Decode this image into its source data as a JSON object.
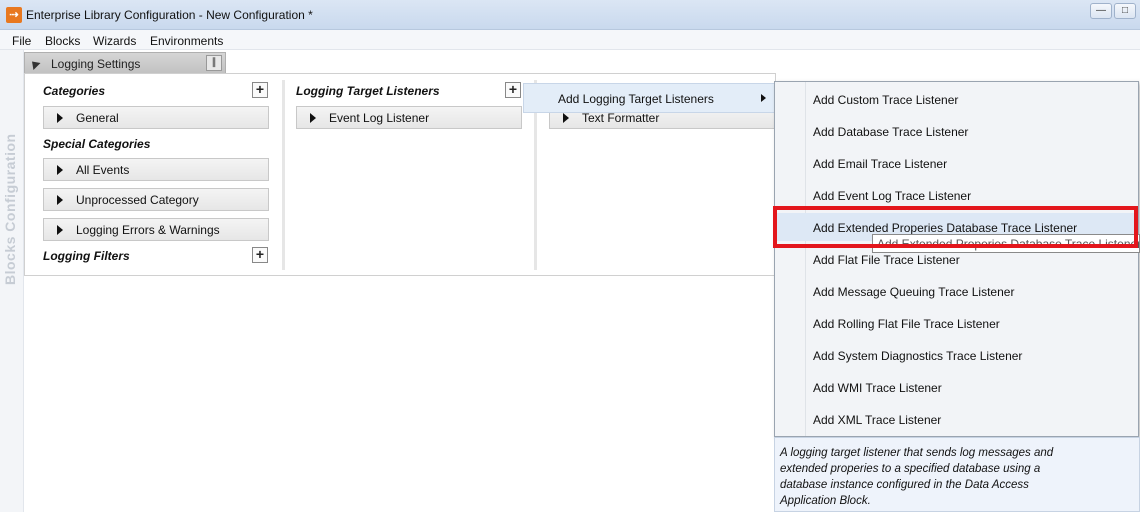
{
  "window": {
    "title": "Enterprise Library Configuration - New Configuration *",
    "app_icon_glyph": "⇢",
    "minimize_glyph": "—",
    "restore_glyph": "□"
  },
  "menu": {
    "file": "File",
    "blocks": "Blocks",
    "wizards": "Wizards",
    "environments": "Environments"
  },
  "sidebar": {
    "vertical_label": "Blocks Configuration"
  },
  "logging_settings": {
    "label": "Logging Settings",
    "collapse_glyph": "∥"
  },
  "categories": {
    "title": "Categories",
    "items": [
      "General"
    ],
    "special_title": "Special Categories",
    "special_items": [
      "All Events",
      "Unprocessed Category",
      "Logging Errors & Warnings"
    ],
    "filters_title": "Logging Filters"
  },
  "listeners": {
    "title": "Logging Target Listeners",
    "items": [
      "Event Log Listener"
    ]
  },
  "formatters": {
    "items": [
      "Text Formatter"
    ]
  },
  "context_menu": {
    "parent_label": "Add Logging Target Listeners",
    "items": [
      "Add Custom Trace Listener",
      "Add Database Trace Listener",
      "Add Email Trace Listener",
      "Add Event Log Trace Listener",
      "Add Extended Properies Database Trace Listener",
      "Add Flat File Trace Listener",
      "Add Message Queuing Trace Listener",
      "Add Rolling Flat File Trace Listener",
      "Add System Diagnostics Trace Listener",
      "Add WMI Trace Listener",
      "Add XML Trace Listener"
    ],
    "tooltip": "Add Extended Properies Database Trace Listener",
    "highlight_color": "#e3161c"
  },
  "description": "A logging target listener that sends log messages and extended properies to a specified database using a database instance configured in the Data Access Application Block."
}
